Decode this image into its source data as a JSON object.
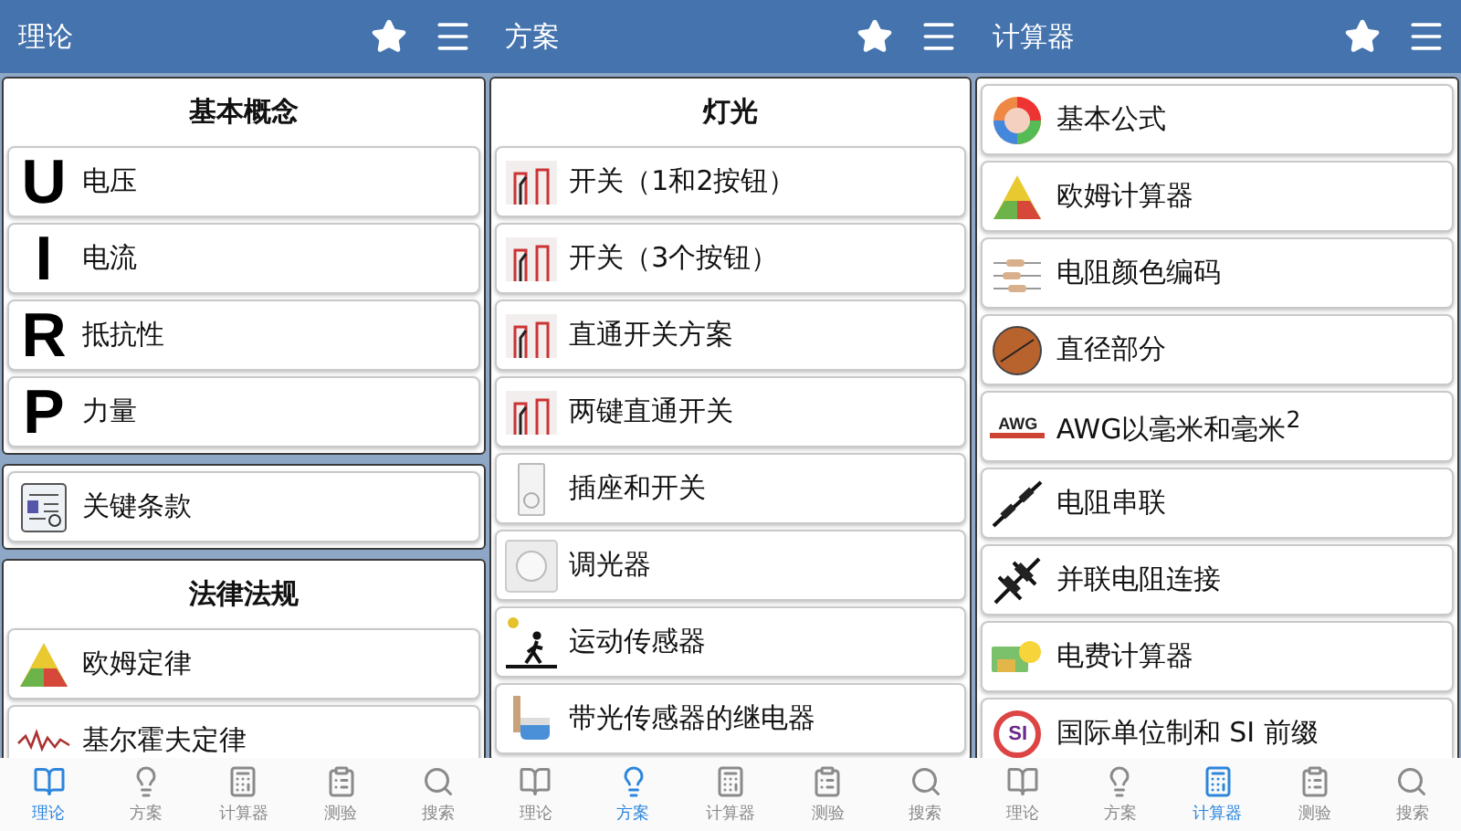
{
  "screens": [
    {
      "title": "理论",
      "sections": [
        {
          "heading": "基本概念",
          "items": [
            {
              "kind": "letter",
              "letter": "U",
              "label": "电压"
            },
            {
              "kind": "letter",
              "letter": "I",
              "label": "电流"
            },
            {
              "kind": "letter",
              "letter": "R",
              "label": "抵抗性"
            },
            {
              "kind": "letter",
              "letter": "P",
              "label": "力量"
            }
          ]
        },
        {
          "items": [
            {
              "kind": "picture",
              "label": "关键条款"
            }
          ]
        },
        {
          "heading": "法律法规",
          "items": [
            {
              "kind": "picture",
              "label": "欧姆定律"
            },
            {
              "kind": "picture",
              "label": "基尔霍夫定律"
            }
          ]
        }
      ],
      "tabs": [
        {
          "label": "理论",
          "selected": true
        },
        {
          "label": "方案",
          "selected": false
        },
        {
          "label": "计算器",
          "selected": false
        },
        {
          "label": "测验",
          "selected": false
        },
        {
          "label": "搜索",
          "selected": false
        }
      ]
    },
    {
      "title": "方案",
      "sections": [
        {
          "heading": "灯光",
          "items": [
            {
              "kind": "picture",
              "label": "开关（1和2按钮）"
            },
            {
              "kind": "picture",
              "label": "开关（3个按钮）"
            },
            {
              "kind": "picture",
              "label": "直通开关方案"
            },
            {
              "kind": "picture",
              "label": "两键直通开关"
            },
            {
              "kind": "picture",
              "label": "插座和开关"
            },
            {
              "kind": "picture",
              "label": "调光器"
            },
            {
              "kind": "picture",
              "label": "运动传感器"
            },
            {
              "kind": "picture",
              "label": "带光传感器的继电器"
            }
          ]
        }
      ],
      "tabs": [
        {
          "label": "理论",
          "selected": false
        },
        {
          "label": "方案",
          "selected": true
        },
        {
          "label": "计算器",
          "selected": false
        },
        {
          "label": "测验",
          "selected": false
        },
        {
          "label": "搜索",
          "selected": false
        }
      ]
    },
    {
      "title": "计算器",
      "sections": [
        {
          "items": [
            {
              "kind": "picture",
              "label": "基本公式"
            },
            {
              "kind": "picture",
              "label": "欧姆计算器"
            },
            {
              "kind": "picture",
              "label": "电阻颜色编码"
            },
            {
              "kind": "picture",
              "label": "直径部分"
            },
            {
              "kind": "badge",
              "badge": "AWG",
              "label": "AWG以毫米和毫米$^{2}$"
            },
            {
              "kind": "picture",
              "label": "电阻串联"
            },
            {
              "kind": "picture",
              "label": "并联电阻连接"
            },
            {
              "kind": "picture",
              "label": "电费计算器"
            },
            {
              "kind": "round-badge",
              "badge": "SI",
              "label": "国际单位制和 SI 前缀"
            }
          ]
        }
      ],
      "tabs": [
        {
          "label": "理论",
          "selected": false
        },
        {
          "label": "方案",
          "selected": false
        },
        {
          "label": "计算器",
          "selected": true
        },
        {
          "label": "测验",
          "selected": false
        },
        {
          "label": "搜索",
          "selected": false
        }
      ]
    }
  ]
}
